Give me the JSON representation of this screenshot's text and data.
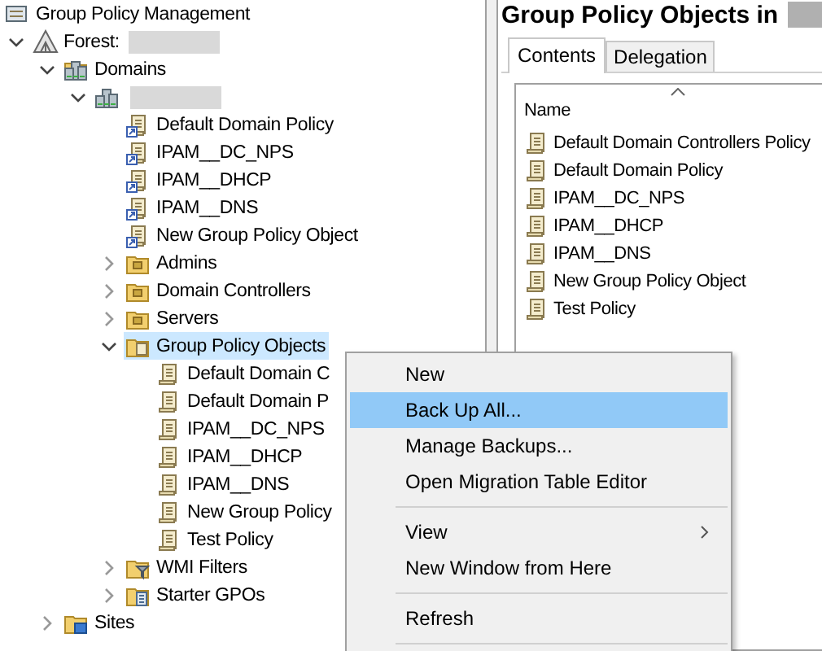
{
  "tree": [
    {
      "label": "Group Policy Management",
      "kind": "root",
      "selected": false,
      "children": [
        {
          "label": "Forest:",
          "kind": "forest",
          "redacted": true,
          "expanded": true,
          "selected": false,
          "children": [
            {
              "label": "Domains",
              "kind": "domains",
              "expanded": true,
              "selected": false,
              "children": [
                {
                  "kind": "domain",
                  "redacted": true,
                  "expanded": true,
                  "selected": false,
                  "children": [
                    {
                      "label": "Default Domain Policy",
                      "kind": "gpo-link",
                      "selected": false
                    },
                    {
                      "label": "IPAM__DC_NPS",
                      "kind": "gpo-link",
                      "selected": false
                    },
                    {
                      "label": "IPAM__DHCP",
                      "kind": "gpo-link",
                      "selected": false
                    },
                    {
                      "label": "IPAM__DNS",
                      "kind": "gpo-link",
                      "selected": false
                    },
                    {
                      "label": "New Group Policy Object",
                      "kind": "gpo-link",
                      "selected": false
                    },
                    {
                      "label": "Admins",
                      "kind": "ou",
                      "expanded": false,
                      "selected": false
                    },
                    {
                      "label": "Domain Controllers",
                      "kind": "ou",
                      "expanded": false,
                      "selected": false
                    },
                    {
                      "label": "Servers",
                      "kind": "ou",
                      "expanded": false,
                      "selected": false
                    },
                    {
                      "label": "Group Policy Objects",
                      "kind": "gpo-folder",
                      "expanded": true,
                      "selected": true,
                      "children": [
                        {
                          "label": "Default Domain C",
                          "kind": "gpo",
                          "selected": false
                        },
                        {
                          "label": "Default Domain P",
                          "kind": "gpo",
                          "selected": false
                        },
                        {
                          "label": "IPAM__DC_NPS",
                          "kind": "gpo",
                          "selected": false
                        },
                        {
                          "label": "IPAM__DHCP",
                          "kind": "gpo",
                          "selected": false
                        },
                        {
                          "label": "IPAM__DNS",
                          "kind": "gpo",
                          "selected": false
                        },
                        {
                          "label": "New Group Policy",
                          "kind": "gpo",
                          "selected": false
                        },
                        {
                          "label": "Test Policy",
                          "kind": "gpo",
                          "selected": false
                        }
                      ]
                    },
                    {
                      "label": "WMI Filters",
                      "kind": "wmi",
                      "expanded": false,
                      "selected": false
                    },
                    {
                      "label": "Starter GPOs",
                      "kind": "starter",
                      "expanded": false,
                      "selected": false
                    }
                  ]
                }
              ]
            },
            {
              "label": "Sites",
              "kind": "sites",
              "expanded": false,
              "selected": false
            }
          ]
        }
      ]
    }
  ],
  "details": {
    "title": "Group Policy Objects in",
    "title_redacted": true,
    "tabs": [
      {
        "label": "Contents",
        "selected": true
      },
      {
        "label": "Delegation",
        "selected": false
      }
    ],
    "columns": [
      {
        "label": "Name",
        "sorted": true
      }
    ],
    "rows": [
      "Default Domain Controllers Policy",
      "Default Domain Policy",
      "IPAM__DC_NPS",
      "IPAM__DHCP",
      "IPAM__DNS",
      "New Group Policy Object",
      "Test Policy"
    ]
  },
  "context_menu": [
    {
      "kind": "item",
      "label": "New",
      "selected": false
    },
    {
      "kind": "item",
      "label": "Back Up All...",
      "selected": true
    },
    {
      "kind": "item",
      "label": "Manage Backups...",
      "selected": false
    },
    {
      "kind": "item",
      "label": "Open Migration Table Editor",
      "selected": false
    },
    {
      "kind": "separator"
    },
    {
      "kind": "item",
      "label": "View",
      "selected": false,
      "submenu": true
    },
    {
      "kind": "item",
      "label": "New Window from Here",
      "selected": false
    },
    {
      "kind": "separator"
    },
    {
      "kind": "item",
      "label": "Refresh",
      "selected": false
    },
    {
      "kind": "separator"
    }
  ]
}
